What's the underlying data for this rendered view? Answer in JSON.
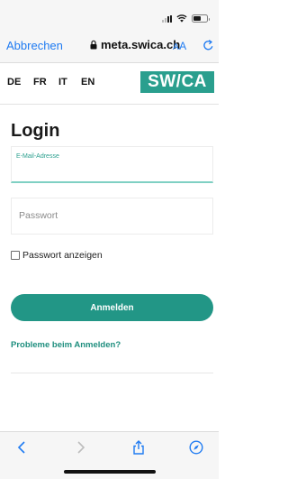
{
  "status_bar": {
    "icons": [
      "cellular-signal-icon",
      "wifi-icon",
      "battery-icon"
    ],
    "battery_level": 0.6
  },
  "browser": {
    "cancel_label": "Abbrechen",
    "url": "meta.swica.ch",
    "text_size_label_small": "A",
    "text_size_label_large": "A",
    "icons": [
      "lock-icon",
      "reload-icon"
    ]
  },
  "languages": [
    "DE",
    "FR",
    "IT",
    "EN"
  ],
  "logo_text": "SW/CA",
  "login": {
    "title": "Login",
    "email_label": "E-Mail-Adresse",
    "email_value": "",
    "password_placeholder": "Passwort",
    "show_password_label": "Passwort anzeigen",
    "show_password_checked": false,
    "submit_label": "Anmelden",
    "help_link": "Probleme beim Anmelden?"
  },
  "toolbar": {
    "icons": [
      "back-icon",
      "forward-icon",
      "share-icon",
      "compass-icon"
    ]
  },
  "colors": {
    "accent": "#229686",
    "link": "#1f7bf2",
    "logo": "#2a9f8e"
  }
}
